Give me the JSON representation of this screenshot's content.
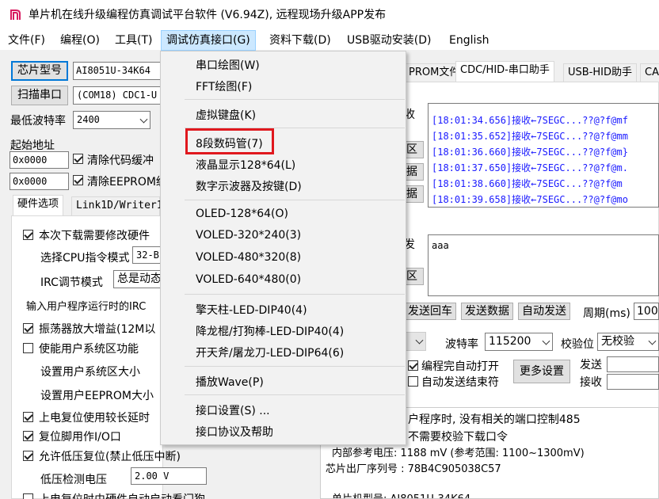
{
  "window": {
    "title": "单片机在线升级编程仿真调试平台软件 (V6.94Z), 远程现场升级APP发布",
    "icon": "stc-isp-app-icon"
  },
  "menubar": {
    "items": [
      {
        "label": "文件(F)"
      },
      {
        "label": "编程(O)"
      },
      {
        "label": "工具(T)"
      },
      {
        "label": "调试仿真接口(G)"
      },
      {
        "label": "资料下载(D)"
      },
      {
        "label": "USB驱动安装(D)"
      },
      {
        "label": "English"
      }
    ]
  },
  "left": {
    "chip_button": "芯片型号",
    "chip_value": "AI8051U-34K64",
    "scan_button": "扫描串口",
    "port_value": "(COM18) CDC1-U",
    "baud_label": "最低波特率",
    "baud_value": "2400",
    "start_addr_label": "起始地址",
    "addr1": "0x0000",
    "clear_code": "清除代码缓冲",
    "addr2": "0x0000",
    "clear_eeprom": "清除EEPROM缓",
    "tabs": [
      {
        "label": "硬件选项"
      },
      {
        "label": "Link1D/Writer1"
      }
    ],
    "options": {
      "modify_hw": "本次下载需要修改硬件",
      "cpu_mode_label": "选择CPU指令模式",
      "cpu_mode_value": "32-B",
      "irc_label": "IRC调节模式",
      "irc_value": "总是动态",
      "input_freq": "输入用户程序运行时的IRC",
      "osc_gain": "振荡器放大增益(12M以",
      "user_sys": "使能用户系统区功能",
      "user_sys_size": "设置用户系统区大小",
      "user_eeprom_size": "设置用户EEPROM大小",
      "reset_delay": "上电复位使用较长延时",
      "reset_pin": "复位脚用作I/O口",
      "low_voltage": "允许低压复位(禁止低压中断)",
      "lv_label": "低压检测电压",
      "lv_value": "2.00 V",
      "last_row": "上电复位时由硬件自动启动看门狗"
    }
  },
  "right": {
    "tabs": [
      {
        "label": "PROM文件"
      },
      {
        "label": "CDC/HID-串口助手"
      },
      {
        "label": "USB-HID助手"
      },
      {
        "label": "CAN"
      }
    ],
    "recv_label": "收",
    "area_btn1": "区",
    "data_btn1": "据",
    "data_btn2": "据",
    "log": [
      "[18:01:34.656]接收←7SEGC...??@?f@mf",
      "[18:01:35.652]接收←7SEGC...??@?f@mm",
      "[18:01:36.660]接收←7SEGC...??@?f@m}",
      "[18:01:37.650]接收←7SEGC...??@?f@m.",
      "[18:01:38.660]接收←7SEGC...??@?f@m",
      "[18:01:39.658]接收←7SEGC...??@?f@mo"
    ],
    "send_label": "发",
    "send_text": "aaa",
    "area_btn2": "区",
    "send_back": "发送回车",
    "send_data": "发送数据",
    "auto_send": "自动发送",
    "period_label": "周期(ms)",
    "period_value": "100",
    "baud_label": "波特率",
    "baud_value": "115200",
    "parity_label": "校验位",
    "parity_value": "无校验",
    "auto_open": "编程完自动打开",
    "auto_stop": "自动发送结束符",
    "more_settings": "更多设置",
    "tx_label": "发送",
    "rx_label": "接收"
  },
  "info": {
    "lines": [
      "户程序时, 没有相关的端口控制485",
      "不需要校验下载口令",
      "  内部参考电压: 1188 mV (参考范围: 1100~1300mV)",
      "芯片出厂序列号 : 78B4C905038C57",
      "  单片机型号: AI8051U-34K64"
    ]
  },
  "dropdown": {
    "items": [
      {
        "label": "串口绘图(W)"
      },
      {
        "label": "FFT绘图(F)"
      },
      {
        "label": "虚拟键盘(K)"
      },
      {
        "label": "8段数码管(7)"
      },
      {
        "label": "液晶显示128*64(L)"
      },
      {
        "label": "数字示波器及按键(D)"
      },
      {
        "label": "OLED-128*64(O)"
      },
      {
        "label": "VOLED-320*240(3)"
      },
      {
        "label": "VOLED-480*320(8)"
      },
      {
        "label": "VOLED-640*480(0)"
      },
      {
        "label": "擎天柱-LED-DIP40(4)"
      },
      {
        "label": "降龙棍/打狗棒-LED-DIP40(4)"
      },
      {
        "label": "开天斧/屠龙刀-LED-DIP64(6)"
      },
      {
        "label": "播放Wave(P)"
      },
      {
        "label": "接口设置(S) ..."
      },
      {
        "label": "接口协议及帮助"
      }
    ],
    "highlight_color": "#e0181e"
  },
  "colors": {
    "accent": "#0078d7",
    "log_text": "#1a1aff",
    "menu_active": "#cce8ff"
  }
}
